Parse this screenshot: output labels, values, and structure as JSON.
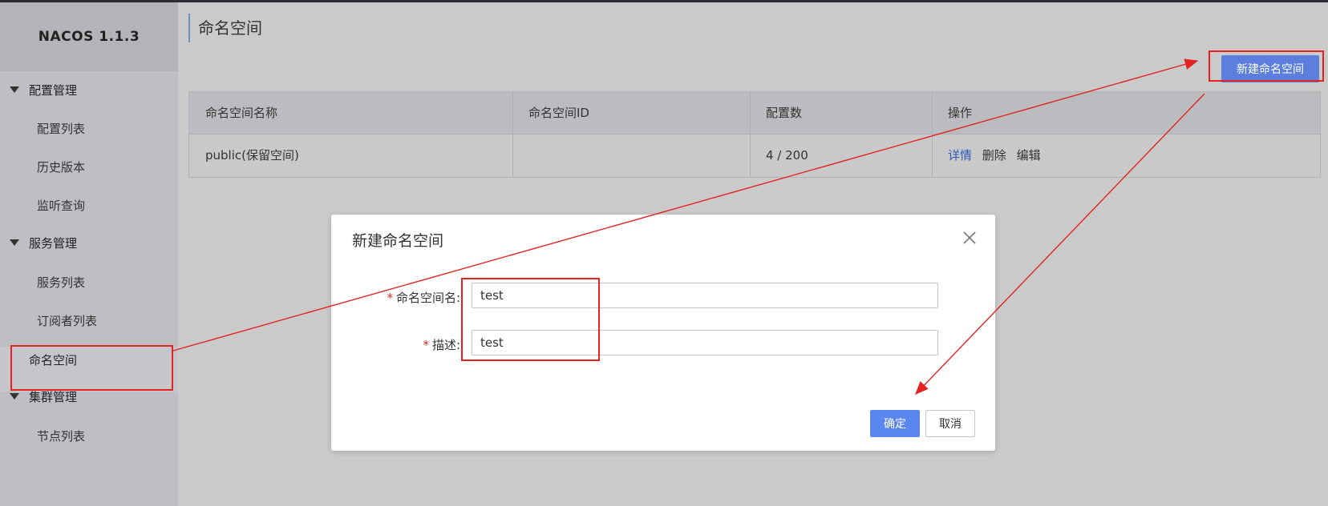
{
  "app": {
    "title": "NACOS 1.1.3"
  },
  "sidebar": {
    "groups": [
      {
        "label": "配置管理",
        "items": [
          "配置列表",
          "历史版本",
          "监听查询"
        ]
      },
      {
        "label": "服务管理",
        "items": [
          "服务列表",
          "订阅者列表",
          "命名空间"
        ]
      },
      {
        "label": "集群管理",
        "items": [
          "节点列表"
        ]
      }
    ],
    "active_item": "命名空间"
  },
  "page": {
    "title": "命名空间",
    "new_button": "新建命名空间"
  },
  "table": {
    "headers": [
      "命名空间名称",
      "命名空间ID",
      "配置数",
      "操作"
    ],
    "rows": [
      {
        "name": "public(保留空间)",
        "id": "",
        "config_count": "4 / 200",
        "actions": [
          "详情",
          "删除",
          "编辑"
        ]
      }
    ]
  },
  "dialog": {
    "title": "新建命名空间",
    "fields": [
      {
        "label": "命名空间名:",
        "value": "test",
        "required_mark": "*"
      },
      {
        "label": "描述:",
        "value": "test",
        "required_mark": "*"
      }
    ],
    "ok_label": "确定",
    "cancel_label": "取消"
  },
  "colors": {
    "annotation": "#e32222",
    "primary": "#5a86f0",
    "link": "#2f5bb7"
  }
}
